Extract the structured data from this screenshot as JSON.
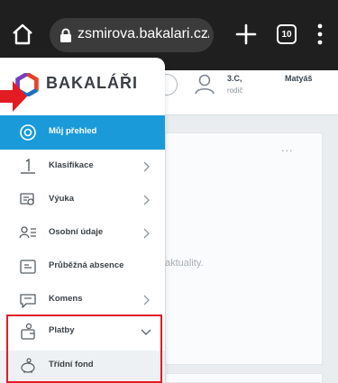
{
  "browser": {
    "url": "zsmirova.bakalari.cz/",
    "tab_count": "10"
  },
  "header": {
    "user_class": "3.C,",
    "user_name": "Matyáš",
    "user_role": "rodič"
  },
  "background": {
    "more": "...",
    "text": "aktuality."
  },
  "sidebar": {
    "brand": "BAKALÁŘI",
    "items": [
      {
        "label": "Můj přehled",
        "icon": "overview-icon",
        "active": true
      },
      {
        "label": "Klasifikace",
        "icon": "grade-icon",
        "chevron": "right"
      },
      {
        "label": "Výuka",
        "icon": "teaching-icon",
        "chevron": "right"
      },
      {
        "label": "Osobní údaje",
        "icon": "personal-data-icon",
        "chevron": "right"
      },
      {
        "label": "Průběžná absence",
        "icon": "absence-icon"
      },
      {
        "label": "Komens",
        "icon": "messages-icon",
        "chevron": "right"
      },
      {
        "label": "Platby",
        "icon": "payments-icon",
        "chevron": "down"
      },
      {
        "label": "Třídní fond",
        "icon": "piggy-bank-icon",
        "sub": true
      }
    ]
  },
  "colors": {
    "accent": "#1a9ad9",
    "highlight": "#e31b23",
    "browser_bg": "#1f1f1f"
  }
}
